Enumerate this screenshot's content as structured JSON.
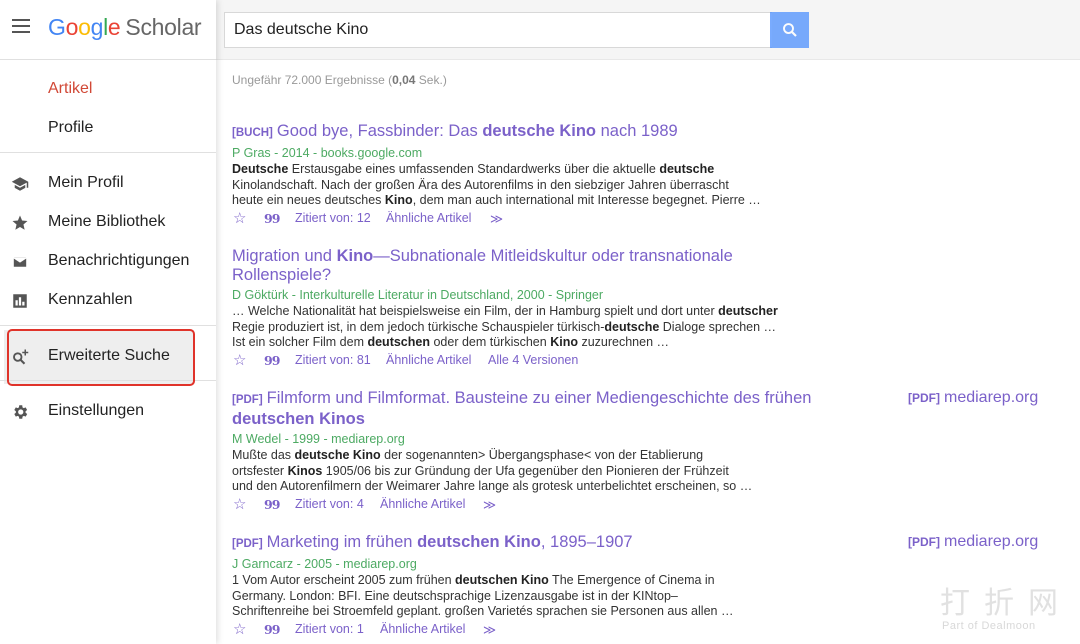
{
  "logo": {
    "g1": "G",
    "g2": "o",
    "g3": "o",
    "g4": "g",
    "g5": "l",
    "g6": "e",
    "scholar": "Scholar"
  },
  "sidebar": {
    "items": [
      {
        "label": "Artikel",
        "active": true
      },
      {
        "label": "Profile"
      },
      {
        "label": "Mein Profil",
        "icon": "graduation-cap-icon"
      },
      {
        "label": "Meine Bibliothek",
        "icon": "star-icon"
      },
      {
        "label": "Benachrichtigungen",
        "icon": "envelope-icon"
      },
      {
        "label": "Kennzahlen",
        "icon": "metrics-icon"
      },
      {
        "label": "Erweiterte Suche",
        "icon": "advanced-search-icon"
      },
      {
        "label": "Einstellungen",
        "icon": "gear-icon"
      }
    ]
  },
  "search": {
    "value": "Das deutsche Kino"
  },
  "results_count": {
    "prefix": "Ungefähr 72.000 Ergebnisse (",
    "time": "0,04",
    "suffix": " Sek.)"
  },
  "results": [
    {
      "tag": "[BUCH]",
      "title_parts": [
        "Good bye, Fassbinder: Das ",
        "deutsche Kino",
        " nach 1989"
      ],
      "meta": "P Gras - 2014 - books.google.com",
      "snippet_lines": [
        [
          "",
          "Deutsche",
          " Erstausgabe eines umfassenden Standardwerks über die aktuelle ",
          "deutsche",
          ""
        ],
        [
          "Kinolandschaft. Nach der großen Ära des Autorenfilms in den siebziger Jahren überrascht"
        ],
        [
          "heute ein neues deutsches ",
          "Kino",
          ", dem man auch international mit Interesse begegnet. Pierre …"
        ]
      ],
      "cited": "Zitiert von: 12",
      "related": "Ähnliche Artikel",
      "versions": ""
    },
    {
      "tag": "",
      "title_line1": [
        "Migration und ",
        "Kino",
        "—Subnationale Mitleidskultur oder transnationale"
      ],
      "title_line2": "Rollenspiele?",
      "meta": "D Göktürk - Interkulturelle Literatur in Deutschland, 2000 - Springer",
      "snippet_lines": [
        [
          "… Welche Nationalität hat beispielsweise ein Film, der in Hamburg spielt und dort unter ",
          "deutscher",
          ""
        ],
        [
          "Regie produziert ist, in dem jedoch türkische Schauspieler türkisch-",
          "deutsche",
          " Dialoge sprechen …"
        ],
        [
          "Ist ein solcher Film dem ",
          "deutschen",
          " oder dem türkischen ",
          "Kino",
          " zuzurechnen …"
        ]
      ],
      "cited": "Zitiert von: 81",
      "related": "Ähnliche Artikel",
      "versions": "Alle 4 Versionen"
    },
    {
      "tag": "[PDF]",
      "title_line1": [
        "Filmform und Filmformat. Bausteine zu einer Mediengeschichte des frühen"
      ],
      "title_line2": "deutschen Kinos",
      "meta": "M Wedel - 1999 - mediarep.org",
      "snippet_lines": [
        [
          "Mußte das ",
          "deutsche Kino",
          " der sogenannten> Übergangsphase< von der Etablierung"
        ],
        [
          "ortsfester ",
          "Kinos",
          " 1905/06 bis zur Gründung der Ufa gegenüber den Pionieren der Frühzeit"
        ],
        [
          "und den Autorenfilmern der Weimarer Jahre lange als grotesk unterbelichtet erscheinen, so …"
        ]
      ],
      "cited": "Zitiert von: 4",
      "related": "Ähnliche Artikel",
      "versions": "",
      "side_tag": "[PDF]",
      "side_link": "mediarep.org"
    },
    {
      "tag": "[PDF]",
      "title_parts": [
        "Marketing im frühen ",
        "deutschen Kino",
        ", 1895–1907"
      ],
      "meta": "J Garncarz - 2005 - mediarep.org",
      "snippet_lines": [
        [
          "1 Vom Autor erscheint 2005 zum frühen ",
          "deutschen Kino",
          " The Emergence of Cinema in"
        ],
        [
          "Germany. London: BFI. Eine deutschsprachige Lizenzausgabe ist in der KINtop–"
        ],
        [
          "Schriftenreihe bei Stroemfeld geplant. großen Varietés sprachen sie Personen aus allen …"
        ]
      ],
      "cited": "Zitiert von: 1",
      "related": "Ähnliche Artikel",
      "versions": "",
      "side_tag": "[PDF]",
      "side_link": "mediarep.org"
    }
  ],
  "actions": {
    "quote_glyph": "99",
    "more_glyph": "≫"
  },
  "watermark": {
    "text": "打折网",
    "sub": "Part of Dealmoon"
  },
  "colors": {
    "link": "#7b61c9",
    "meta": "#4daa63",
    "active": "#d14836",
    "search_button": "#4d90fe",
    "annotation": "#e0332a"
  }
}
